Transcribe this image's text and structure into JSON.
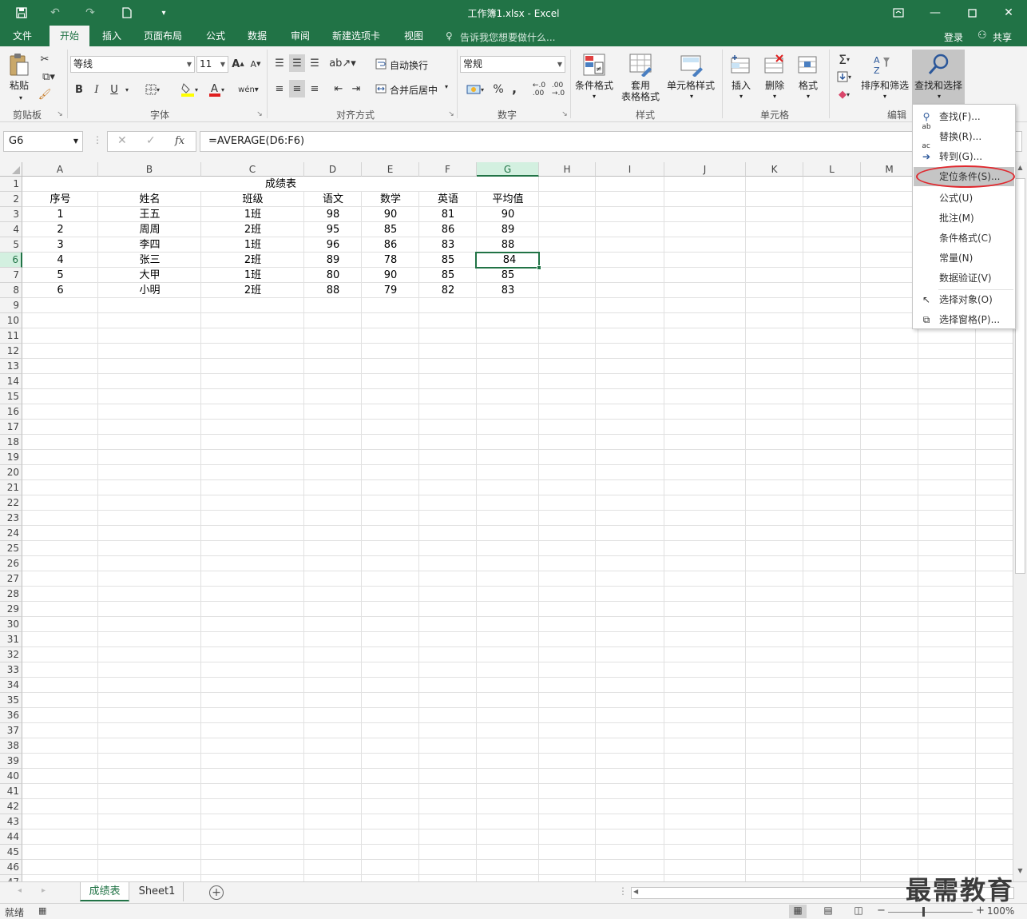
{
  "window": {
    "title": "工作簿1.xlsx - Excel"
  },
  "ribbon_tabs": [
    "文件",
    "开始",
    "插入",
    "页面布局",
    "公式",
    "数据",
    "审阅",
    "新建选项卡",
    "视图"
  ],
  "tell_me": "告诉我您想要做什么...",
  "account": {
    "login": "登录",
    "share": "共享"
  },
  "clipboard": {
    "paste": "粘贴",
    "group": "剪贴板"
  },
  "font": {
    "name": "等线",
    "size": "11",
    "group": "字体",
    "bold": "B",
    "italic": "I",
    "underline": "U"
  },
  "alignment": {
    "wrap": "自动换行",
    "merge": "合并后居中",
    "group": "对齐方式"
  },
  "number": {
    "format": "常规",
    "percent": "%",
    "comma": ",",
    "group": "数字"
  },
  "styles": {
    "conditional": "条件格式",
    "table_line1": "套用",
    "table_line2": "表格格式",
    "cell_styles": "单元格样式",
    "group": "样式"
  },
  "cells": {
    "insert": "插入",
    "delete": "删除",
    "format": "格式",
    "group": "单元格"
  },
  "editing": {
    "sort_filter": "排序和筛选",
    "find_select": "查找和选择",
    "group": "编辑"
  },
  "formula_bar": {
    "name_box": "G6",
    "fx": "fx",
    "formula": "=AVERAGE(D6:F6)"
  },
  "columns": [
    "A",
    "B",
    "C",
    "D",
    "E",
    "F",
    "G",
    "H",
    "I",
    "J",
    "K",
    "L",
    "M"
  ],
  "rows": [
    "1",
    "2",
    "3",
    "4",
    "5",
    "6",
    "7",
    "8",
    "9",
    "10",
    "11",
    "12",
    "13",
    "14",
    "15",
    "16",
    "17",
    "18",
    "19",
    "20",
    "21",
    "22",
    "23",
    "24",
    "25",
    "26",
    "27",
    "28",
    "29",
    "30",
    "31",
    "32",
    "33",
    "34",
    "35",
    "36",
    "37",
    "38",
    "39",
    "40",
    "41",
    "42",
    "43",
    "44",
    "45",
    "46",
    "47"
  ],
  "sheet": {
    "title": "成绩表",
    "headers": [
      "序号",
      "姓名",
      "班级",
      "语文",
      "数学",
      "英语",
      "平均值"
    ],
    "rows": [
      [
        "1",
        "王五",
        "1班",
        "98",
        "90",
        "81",
        "90"
      ],
      [
        "2",
        "周周",
        "2班",
        "95",
        "85",
        "86",
        "89"
      ],
      [
        "3",
        "李四",
        "1班",
        "96",
        "86",
        "83",
        "88"
      ],
      [
        "4",
        "张三",
        "2班",
        "89",
        "78",
        "85",
        "84"
      ],
      [
        "5",
        "大甲",
        "1班",
        "80",
        "90",
        "85",
        "85"
      ],
      [
        "6",
        "小明",
        "2班",
        "88",
        "79",
        "82",
        "83"
      ]
    ]
  },
  "find_menu": {
    "items": [
      "查找(F)...",
      "替换(R)...",
      "转到(G)...",
      "定位条件(S)...",
      "公式(U)",
      "批注(M)",
      "条件格式(C)",
      "常量(N)",
      "数据验证(V)",
      "选择对象(O)",
      "选择窗格(P)..."
    ]
  },
  "sheet_tabs": [
    "成绩表",
    "Sheet1"
  ],
  "status": {
    "ready": "就绪",
    "zoom": "100%"
  },
  "watermark": "最需教育",
  "colors": {
    "accent": "#217346",
    "highlight_oval": "#e0282e"
  }
}
